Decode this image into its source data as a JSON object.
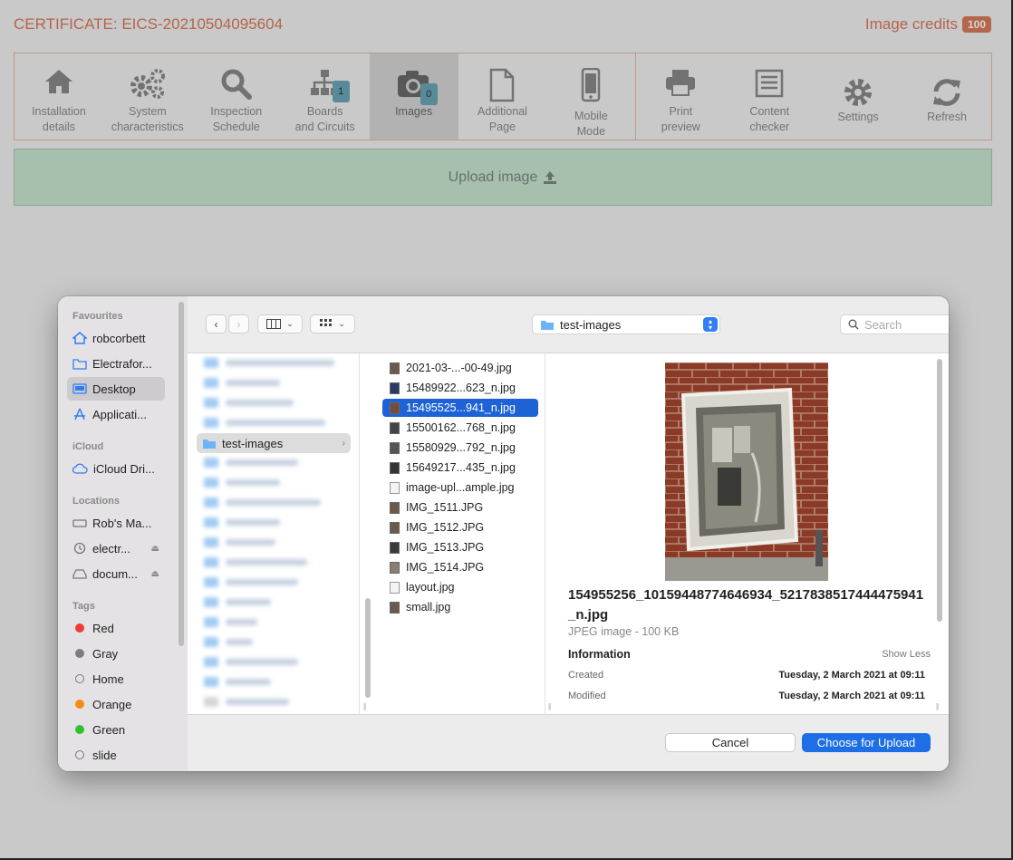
{
  "app": {
    "certificate_title": "CERTIFICATE: EICS-20210504095604",
    "credits_label": "Image credits",
    "credits_count": "100"
  },
  "toolbar": {
    "installation": [
      "Installation",
      "details"
    ],
    "system": [
      "System",
      "characteristics"
    ],
    "inspection": [
      "Inspection",
      "Schedule"
    ],
    "boards": [
      "Boards",
      "and Circuits"
    ],
    "boards_count": "1",
    "images": "Images",
    "images_count": "0",
    "additional": [
      "Additional",
      "Page"
    ],
    "mobile": [
      "Mobile",
      "Mode"
    ],
    "print": [
      "Print",
      "preview"
    ],
    "content": [
      "Content",
      "checker"
    ],
    "settings": "Settings",
    "refresh": "Refresh"
  },
  "upload_label": "Upload image",
  "dialog": {
    "sidebar": {
      "favourites_heading": "Favourites",
      "favourites": [
        "robcorbett",
        "Electrafor...",
        "Desktop",
        "Applicati..."
      ],
      "icloud_heading": "iCloud",
      "icloud": [
        "iCloud Dri..."
      ],
      "locations_heading": "Locations",
      "locations": [
        "Rob's Ma...",
        "electr...",
        "docum..."
      ],
      "tags_heading": "Tags",
      "tags": [
        "Red",
        "Gray",
        "Home",
        "Orange",
        "Green",
        "slide"
      ],
      "tag_colors": [
        "#ef3b33",
        "#7d7d7d",
        "",
        "#f48b14",
        "#2fc12f",
        ""
      ]
    },
    "path": "test-images",
    "search_placeholder": "Search",
    "selected_folder": "test-images",
    "files": [
      "2021-03-...-00-49.jpg",
      "15489922...623_n.jpg",
      "15495525...941_n.jpg",
      "15500162...768_n.jpg",
      "15580929...792_n.jpg",
      "15649217...435_n.jpg",
      "image-upl...ample.jpg",
      "IMG_1511.JPG",
      "IMG_1512.JPG",
      "IMG_1513.JPG",
      "IMG_1514.JPG",
      "layout.jpg",
      "small.jpg"
    ],
    "selected_file_index": 2,
    "preview": {
      "file_name": "154955256_10159448774646934_5217838517444475941_n.jpg",
      "kind": "JPEG image - 100 KB",
      "information_label": "Information",
      "show_less": "Show Less",
      "created_label": "Created",
      "created_value": "Tuesday, 2 March 2021 at 09:11",
      "modified_label": "Modified",
      "modified_value": "Tuesday, 2 March 2021 at 09:11"
    },
    "cancel_label": "Cancel",
    "choose_label": "Choose for Upload"
  }
}
